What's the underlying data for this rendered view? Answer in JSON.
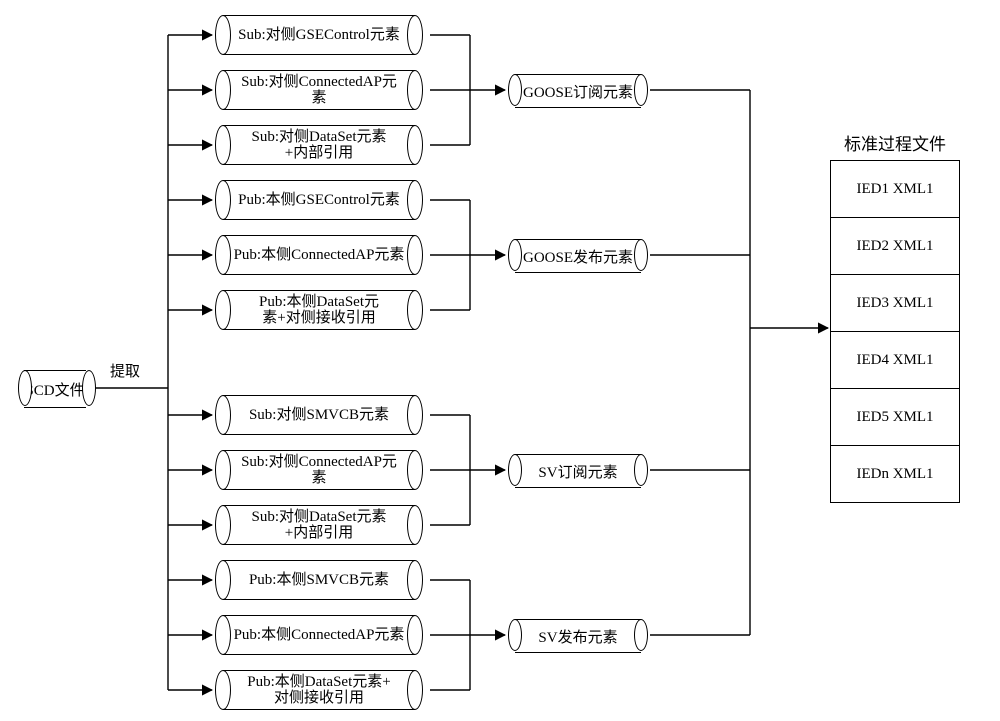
{
  "source_label": "SCD文件",
  "extract_label": "提取",
  "mids": [
    "Sub:对侧GSEControl元素",
    "Sub:对侧ConnectedAP元\n素",
    "Sub:对侧DataSet元素\n+内部引用",
    "Pub:本侧GSEControl元素",
    "Pub:本侧ConnectedAP元素",
    "Pub:本侧DataSet元\n素+对侧接收引用",
    "Sub:对侧SMVCB元素",
    "Sub:对侧ConnectedAP元\n素",
    "Sub:对侧DataSet元素\n+内部引用",
    "Pub:本侧SMVCB元素",
    "Pub:本侧ConnectedAP元素",
    "Pub:本侧DataSet元素+\n对侧接收引用"
  ],
  "results": [
    "GOOSE订阅元素",
    "GOOSE发布元素",
    "SV订阅元素",
    "SV发布元素"
  ],
  "output_title": "标准过程文件",
  "outputs": [
    "IED1 XML1",
    "IED2 XML1",
    "IED3 XML1",
    "IED4 XML1",
    "IED5 XML1",
    "IEDn XML1"
  ]
}
